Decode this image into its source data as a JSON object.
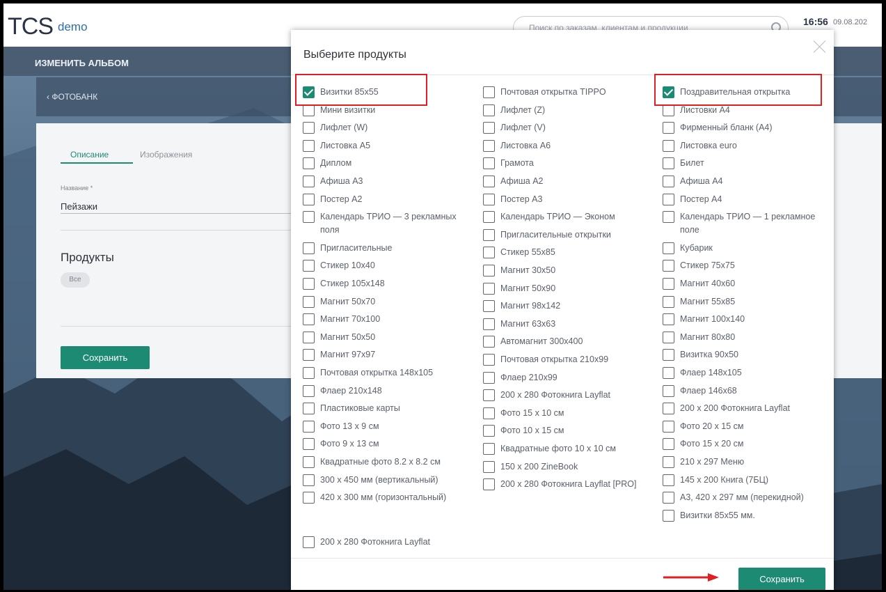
{
  "app": {
    "logo": "TCS",
    "logo_sub": "demo"
  },
  "header": {
    "search_placeholder": "Поиск по заказам, клиентам и продукции",
    "time": "16:56",
    "date": "09.08.202"
  },
  "subheader": {
    "title": "ИЗМЕНИТЬ АЛЬБОМ"
  },
  "breadcrumb": {
    "back_label": "‹ ФОТОБАНК"
  },
  "form": {
    "tabs": [
      "Описание",
      "Изображения"
    ],
    "name_label": "Название *",
    "name_value": "Пейзажи",
    "products_title": "Продукты",
    "chip_all": "Все",
    "save_label": "Сохранить"
  },
  "modal": {
    "title": "Выберите продукты",
    "save_label": "Сохранить",
    "columns": [
      [
        {
          "label": "Визитки 85х55",
          "checked": true
        },
        {
          "label": "Мини визитки",
          "checked": false
        },
        {
          "label": "Лифлет (W)",
          "checked": false
        },
        {
          "label": "Листовка А5",
          "checked": false
        },
        {
          "label": "Диплом",
          "checked": false
        },
        {
          "label": "Афиша А3",
          "checked": false
        },
        {
          "label": "Постер А2",
          "checked": false
        },
        {
          "label": "Календарь ТРИО — 3 рекламных поля",
          "checked": false
        },
        {
          "label": "Пригласительные",
          "checked": false
        },
        {
          "label": "Стикер 10х40",
          "checked": false
        },
        {
          "label": "Стикер 105х148",
          "checked": false
        },
        {
          "label": "Магнит 50х70",
          "checked": false
        },
        {
          "label": "Магнит 70х100",
          "checked": false
        },
        {
          "label": "Магнит 50х50",
          "checked": false
        },
        {
          "label": "Магнит 97х97",
          "checked": false
        },
        {
          "label": "Почтовая открытка 148х105",
          "checked": false
        },
        {
          "label": "Флаер 210х148",
          "checked": false
        },
        {
          "label": "Пластиковые карты",
          "checked": false
        },
        {
          "label": "Фото 13 х 9 см",
          "checked": false
        },
        {
          "label": "Фото 9 х 13 см",
          "checked": false
        },
        {
          "label": "Квадратные фото 8.2 х 8.2 см",
          "checked": false
        },
        {
          "label": "300 х 450 мм (вертикальный)",
          "checked": false
        },
        {
          "label": "420 х 300 мм (горизонтальный)",
          "checked": false
        },
        {
          "label": "200 х 280 Фотокнига Layflat",
          "checked": false
        }
      ],
      [
        {
          "label": "Почтовая открытка TIPPO",
          "checked": false
        },
        {
          "label": "Лифлет (Z)",
          "checked": false
        },
        {
          "label": "Лифлет (V)",
          "checked": false
        },
        {
          "label": "Листовка А6",
          "checked": false
        },
        {
          "label": "Грамота",
          "checked": false
        },
        {
          "label": "Афиша А2",
          "checked": false
        },
        {
          "label": "Постер А3",
          "checked": false
        },
        {
          "label": "Календарь ТРИО — Эконом",
          "checked": false
        },
        {
          "label": "Пригласительные открытки",
          "checked": false
        },
        {
          "label": "Стикер 55х85",
          "checked": false
        },
        {
          "label": "Магнит 30х50",
          "checked": false
        },
        {
          "label": "Магнит 50х90",
          "checked": false
        },
        {
          "label": "Магнит 98х142",
          "checked": false
        },
        {
          "label": "Магнит 63х63",
          "checked": false
        },
        {
          "label": "Автомагнит 300х400",
          "checked": false
        },
        {
          "label": "Почтовая открытка 210х99",
          "checked": false
        },
        {
          "label": "Флаер 210х99",
          "checked": false
        },
        {
          "label": "200 х 280 Фотокнига Layflat",
          "checked": false
        },
        {
          "label": "Фото 15 х 10 см",
          "checked": false
        },
        {
          "label": "Фото 10 х 15 см",
          "checked": false
        },
        {
          "label": "Квадратные фото 10 х 10 см",
          "checked": false
        },
        {
          "label": "150 х 200 ZineBook",
          "checked": false
        },
        {
          "label": "200 х 280 Фотокнига Layflat [PRO]",
          "checked": false
        }
      ],
      [
        {
          "label": "Поздравительная открытка",
          "checked": true
        },
        {
          "label": "Листовки А4",
          "checked": false
        },
        {
          "label": "Фирменный бланк (А4)",
          "checked": false
        },
        {
          "label": "Листовка euro",
          "checked": false
        },
        {
          "label": "Билет",
          "checked": false
        },
        {
          "label": "Афиша А4",
          "checked": false
        },
        {
          "label": "Постер А4",
          "checked": false
        },
        {
          "label": "Календарь ТРИО — 1 рекламное поле",
          "checked": false
        },
        {
          "label": "Кубарик",
          "checked": false
        },
        {
          "label": "Стикер 75х75",
          "checked": false
        },
        {
          "label": "Магнит 40х60",
          "checked": false
        },
        {
          "label": "Магнит 55х85",
          "checked": false
        },
        {
          "label": "Магнит 100х140",
          "checked": false
        },
        {
          "label": "Магнит 80х80",
          "checked": false
        },
        {
          "label": "Визитка 90х50",
          "checked": false
        },
        {
          "label": "Флаер 148х105",
          "checked": false
        },
        {
          "label": "Флаер 146х68",
          "checked": false
        },
        {
          "label": "200 х 200 Фотокнига Layflat",
          "checked": false
        },
        {
          "label": "Фото 20 х 15 см",
          "checked": false
        },
        {
          "label": "Фото 15 х 20 см",
          "checked": false
        },
        {
          "label": "210 х 297 Меню",
          "checked": false
        },
        {
          "label": "145 х 200 Книга (7БЦ)",
          "checked": false
        },
        {
          "label": "А3, 420 х 297 мм (перекидной)",
          "checked": false
        },
        {
          "label": "Визитки 85х55 мм.",
          "checked": false
        }
      ]
    ]
  },
  "colors": {
    "accent": "#1d8a73",
    "highlight": "#e02020"
  }
}
